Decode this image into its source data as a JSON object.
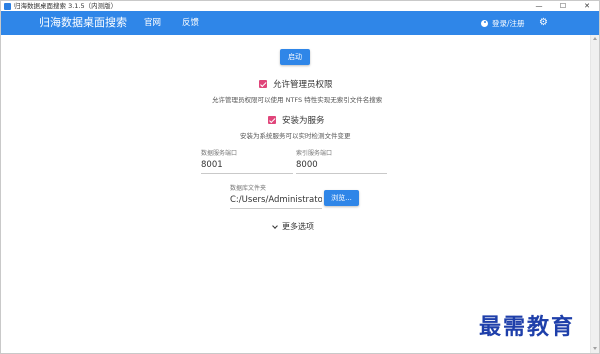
{
  "window": {
    "title": "归海数据桌面搜索 3.1.5（内测版）",
    "controls": {
      "minimize": "—",
      "maximize": "☐",
      "close": "✕"
    }
  },
  "header": {
    "brand": "归海数据桌面搜索",
    "nav": {
      "official": "官网",
      "feedback": "反馈"
    },
    "login": "登录/注册",
    "settings_icon": "gear-icon"
  },
  "main": {
    "start_button": "启动",
    "admin": {
      "label": "允许管理员权限",
      "checked": true,
      "description": "允许管理员权限可以使用 NTFS 特性实现无索引文件名搜索"
    },
    "service": {
      "label": "安装为服务",
      "checked": true,
      "description": "安装为系统服务可以实时检测文件变更"
    },
    "db_port": {
      "label": "数据服务端口",
      "value": "8001"
    },
    "index_port": {
      "label": "索引服务端口",
      "value": "8000"
    },
    "db_folder": {
      "label": "数据库文件夹",
      "value": "C:/Users/Administrator/C"
    },
    "browse_button": "浏览...",
    "more_options": "更多选项"
  },
  "watermark": "最需教育",
  "colors": {
    "accent": "#2f86e8",
    "checkbox": "#e0457a",
    "watermark": "#1e3faa"
  }
}
